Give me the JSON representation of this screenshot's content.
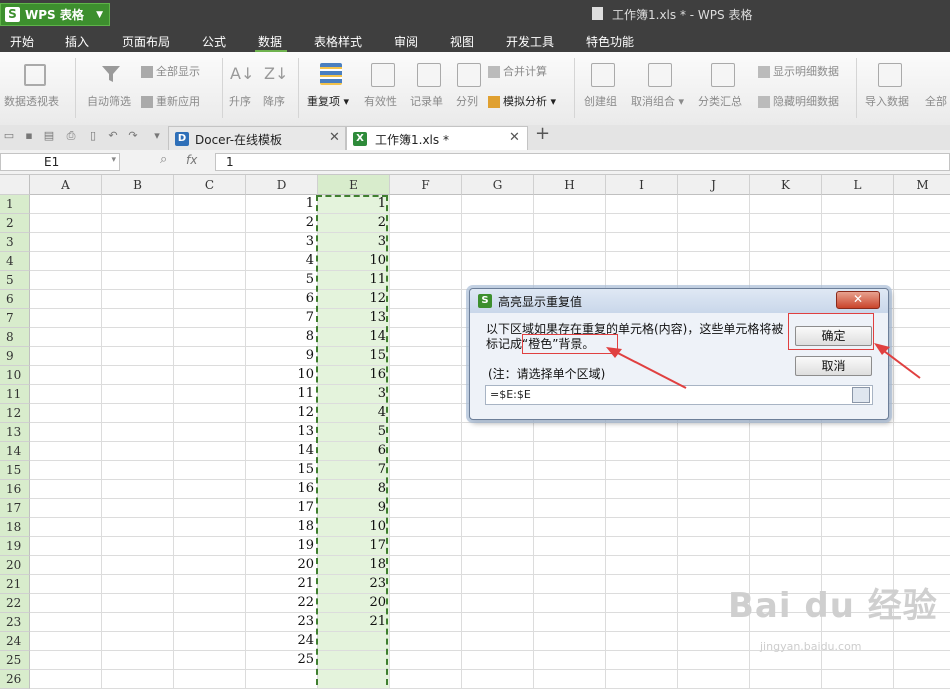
{
  "app": {
    "name": "WPS 表格",
    "logo": "S",
    "doc_title": "工作簿1.xls * - WPS 表格"
  },
  "menu": [
    "开始",
    "插入",
    "页面布局",
    "公式",
    "数据",
    "表格样式",
    "审阅",
    "视图",
    "开发工具",
    "特色功能"
  ],
  "ribbon": {
    "pivot": "数据透视表",
    "autofilter": "自动筛选",
    "show_all": "全部显示",
    "reapply": "重新应用",
    "asc": "升序",
    "desc": "降序",
    "duplicates": "重复项",
    "validity": "有效性",
    "record": "记录单",
    "split": "分列",
    "merge_calc": "合并计算",
    "simulate": "模拟分析",
    "group": "创建组",
    "ungroup": "取消组合",
    "subtotal": "分类汇总",
    "show_detail": "显示明细数据",
    "hide_detail": "隐藏明细数据",
    "import": "导入数据",
    "more": "全部"
  },
  "tabs": [
    {
      "label": "Docer-在线模板",
      "active": false
    },
    {
      "label": "工作簿1.xls *",
      "active": true
    }
  ],
  "formula_bar": {
    "name_box": "E1",
    "fx": "fx",
    "value": "1"
  },
  "columns": [
    "A",
    "B",
    "C",
    "D",
    "E",
    "F",
    "G",
    "H",
    "I",
    "J",
    "K",
    "L",
    "M"
  ],
  "rows": [
    "1",
    "2",
    "3",
    "4",
    "5",
    "6",
    "7",
    "8",
    "9",
    "10",
    "11",
    "12",
    "13",
    "14",
    "15",
    "16",
    "17",
    "18",
    "19",
    "20",
    "21",
    "22",
    "23",
    "24",
    "25",
    "26"
  ],
  "col_D": [
    "1",
    "2",
    "3",
    "4",
    "5",
    "6",
    "7",
    "8",
    "9",
    "10",
    "11",
    "12",
    "13",
    "14",
    "15",
    "16",
    "17",
    "18",
    "19",
    "20",
    "21",
    "22",
    "23",
    "24",
    "25",
    ""
  ],
  "col_E": [
    "1",
    "2",
    "3",
    "10",
    "11",
    "12",
    "13",
    "14",
    "15",
    "16",
    "3",
    "4",
    "5",
    "6",
    "7",
    "8",
    "9",
    "10",
    "17",
    "18",
    "23",
    "20",
    "21",
    "",
    "",
    ""
  ],
  "dialog": {
    "title": "高亮显示重复值",
    "message": "以下区域如果存在重复的单元格(内容)，这些单元格将被标记成“橙色”背景。",
    "note": "(注：请选择单个区域)",
    "range": "=$E:$E",
    "ok": "确定",
    "cancel": "取消"
  },
  "watermark": {
    "text": "Bai du 经验",
    "url": "jingyan.baidu.com"
  },
  "colors": {
    "accent_green": "#3d8f2e",
    "selection_fill": "#e4f3dc",
    "annotation_red": "#e04040"
  }
}
